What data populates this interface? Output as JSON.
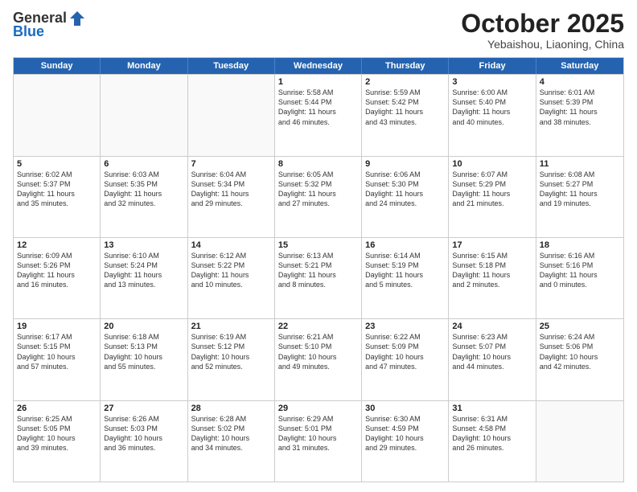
{
  "logo": {
    "general": "General",
    "blue": "Blue"
  },
  "header": {
    "month": "October 2025",
    "location": "Yebaishou, Liaoning, China"
  },
  "days": [
    "Sunday",
    "Monday",
    "Tuesday",
    "Wednesday",
    "Thursday",
    "Friday",
    "Saturday"
  ],
  "weeks": [
    [
      {
        "day": "",
        "text": ""
      },
      {
        "day": "",
        "text": ""
      },
      {
        "day": "",
        "text": ""
      },
      {
        "day": "1",
        "text": "Sunrise: 5:58 AM\nSunset: 5:44 PM\nDaylight: 11 hours\nand 46 minutes."
      },
      {
        "day": "2",
        "text": "Sunrise: 5:59 AM\nSunset: 5:42 PM\nDaylight: 11 hours\nand 43 minutes."
      },
      {
        "day": "3",
        "text": "Sunrise: 6:00 AM\nSunset: 5:40 PM\nDaylight: 11 hours\nand 40 minutes."
      },
      {
        "day": "4",
        "text": "Sunrise: 6:01 AM\nSunset: 5:39 PM\nDaylight: 11 hours\nand 38 minutes."
      }
    ],
    [
      {
        "day": "5",
        "text": "Sunrise: 6:02 AM\nSunset: 5:37 PM\nDaylight: 11 hours\nand 35 minutes."
      },
      {
        "day": "6",
        "text": "Sunrise: 6:03 AM\nSunset: 5:35 PM\nDaylight: 11 hours\nand 32 minutes."
      },
      {
        "day": "7",
        "text": "Sunrise: 6:04 AM\nSunset: 5:34 PM\nDaylight: 11 hours\nand 29 minutes."
      },
      {
        "day": "8",
        "text": "Sunrise: 6:05 AM\nSunset: 5:32 PM\nDaylight: 11 hours\nand 27 minutes."
      },
      {
        "day": "9",
        "text": "Sunrise: 6:06 AM\nSunset: 5:30 PM\nDaylight: 11 hours\nand 24 minutes."
      },
      {
        "day": "10",
        "text": "Sunrise: 6:07 AM\nSunset: 5:29 PM\nDaylight: 11 hours\nand 21 minutes."
      },
      {
        "day": "11",
        "text": "Sunrise: 6:08 AM\nSunset: 5:27 PM\nDaylight: 11 hours\nand 19 minutes."
      }
    ],
    [
      {
        "day": "12",
        "text": "Sunrise: 6:09 AM\nSunset: 5:26 PM\nDaylight: 11 hours\nand 16 minutes."
      },
      {
        "day": "13",
        "text": "Sunrise: 6:10 AM\nSunset: 5:24 PM\nDaylight: 11 hours\nand 13 minutes."
      },
      {
        "day": "14",
        "text": "Sunrise: 6:12 AM\nSunset: 5:22 PM\nDaylight: 11 hours\nand 10 minutes."
      },
      {
        "day": "15",
        "text": "Sunrise: 6:13 AM\nSunset: 5:21 PM\nDaylight: 11 hours\nand 8 minutes."
      },
      {
        "day": "16",
        "text": "Sunrise: 6:14 AM\nSunset: 5:19 PM\nDaylight: 11 hours\nand 5 minutes."
      },
      {
        "day": "17",
        "text": "Sunrise: 6:15 AM\nSunset: 5:18 PM\nDaylight: 11 hours\nand 2 minutes."
      },
      {
        "day": "18",
        "text": "Sunrise: 6:16 AM\nSunset: 5:16 PM\nDaylight: 11 hours\nand 0 minutes."
      }
    ],
    [
      {
        "day": "19",
        "text": "Sunrise: 6:17 AM\nSunset: 5:15 PM\nDaylight: 10 hours\nand 57 minutes."
      },
      {
        "day": "20",
        "text": "Sunrise: 6:18 AM\nSunset: 5:13 PM\nDaylight: 10 hours\nand 55 minutes."
      },
      {
        "day": "21",
        "text": "Sunrise: 6:19 AM\nSunset: 5:12 PM\nDaylight: 10 hours\nand 52 minutes."
      },
      {
        "day": "22",
        "text": "Sunrise: 6:21 AM\nSunset: 5:10 PM\nDaylight: 10 hours\nand 49 minutes."
      },
      {
        "day": "23",
        "text": "Sunrise: 6:22 AM\nSunset: 5:09 PM\nDaylight: 10 hours\nand 47 minutes."
      },
      {
        "day": "24",
        "text": "Sunrise: 6:23 AM\nSunset: 5:07 PM\nDaylight: 10 hours\nand 44 minutes."
      },
      {
        "day": "25",
        "text": "Sunrise: 6:24 AM\nSunset: 5:06 PM\nDaylight: 10 hours\nand 42 minutes."
      }
    ],
    [
      {
        "day": "26",
        "text": "Sunrise: 6:25 AM\nSunset: 5:05 PM\nDaylight: 10 hours\nand 39 minutes."
      },
      {
        "day": "27",
        "text": "Sunrise: 6:26 AM\nSunset: 5:03 PM\nDaylight: 10 hours\nand 36 minutes."
      },
      {
        "day": "28",
        "text": "Sunrise: 6:28 AM\nSunset: 5:02 PM\nDaylight: 10 hours\nand 34 minutes."
      },
      {
        "day": "29",
        "text": "Sunrise: 6:29 AM\nSunset: 5:01 PM\nDaylight: 10 hours\nand 31 minutes."
      },
      {
        "day": "30",
        "text": "Sunrise: 6:30 AM\nSunset: 4:59 PM\nDaylight: 10 hours\nand 29 minutes."
      },
      {
        "day": "31",
        "text": "Sunrise: 6:31 AM\nSunset: 4:58 PM\nDaylight: 10 hours\nand 26 minutes."
      },
      {
        "day": "",
        "text": ""
      }
    ]
  ]
}
